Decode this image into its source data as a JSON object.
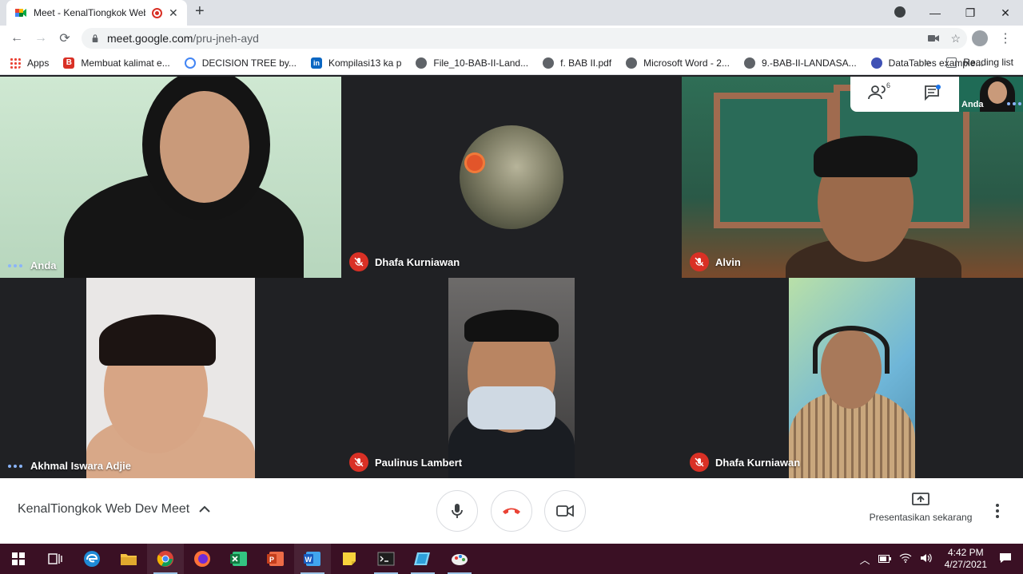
{
  "browser": {
    "tab_title": "Meet - KenalTiongkok Web D",
    "new_tab_label": "+",
    "url_host": "meet.google.com",
    "url_path": "/pru-jneh-ayd"
  },
  "bookmarks": [
    {
      "label": "Apps",
      "icon": "apps-grid-icon",
      "color": "#ea4335"
    },
    {
      "label": "Membuat kalimat e...",
      "icon": "bookmark-b-icon",
      "color": "#d93025"
    },
    {
      "label": "DECISION TREE by...",
      "icon": "bookmark-circle-icon",
      "color": "#4285f4"
    },
    {
      "label": "Kompilasi13 ka p",
      "icon": "linkedin-icon",
      "color": "#0a66c2"
    },
    {
      "label": "File_10-BAB-II-Land...",
      "icon": "globe-icon",
      "color": "#5f6368"
    },
    {
      "label": "f. BAB II.pdf",
      "icon": "globe-icon",
      "color": "#5f6368"
    },
    {
      "label": "Microsoft Word - 2...",
      "icon": "globe-icon",
      "color": "#5f6368"
    },
    {
      "label": "9.-BAB-II-LANDASA...",
      "icon": "globe-icon",
      "color": "#5f6368"
    },
    {
      "label": "DataTables example...",
      "icon": "datatables-icon",
      "color": "#3f51b5"
    }
  ],
  "bookmarks_more": "»",
  "reading_list": "Reading list",
  "participants": [
    {
      "name": "Anda",
      "status": "speaking-dots"
    },
    {
      "name": "Dhafa Kurniawan",
      "status": "muted"
    },
    {
      "name": "Alvin",
      "status": "muted"
    },
    {
      "name": "Akhmal Iswara Adjie",
      "status": "speaking-dots"
    },
    {
      "name": "Paulinus Lambert",
      "status": "muted"
    },
    {
      "name": "Dhafa Kurniawan",
      "status": "muted"
    }
  ],
  "self_preview": {
    "label": "Anda"
  },
  "people_count_badge": "6",
  "meeting": {
    "title": "KenalTiongkok Web Dev Meet",
    "present_label": "Presentasikan sekarang"
  },
  "colors": {
    "stage": "#202124",
    "mute_red": "#d93025",
    "hangup_red": "#ea4335",
    "speaking_blue": "#8ab4f8",
    "taskbar": "#3a1024"
  },
  "taskbar": {
    "time": "4:42 PM",
    "date": "4/27/2021",
    "apps": [
      "start-icon",
      "task-view-icon",
      "edge-icon",
      "file-explorer-icon",
      "chrome-icon",
      "firefox-icon",
      "excel-icon",
      "powerpoint-icon",
      "word-icon",
      "sticky-notes-icon",
      "terminal-icon",
      "app-icon",
      "paint-icon"
    ]
  }
}
